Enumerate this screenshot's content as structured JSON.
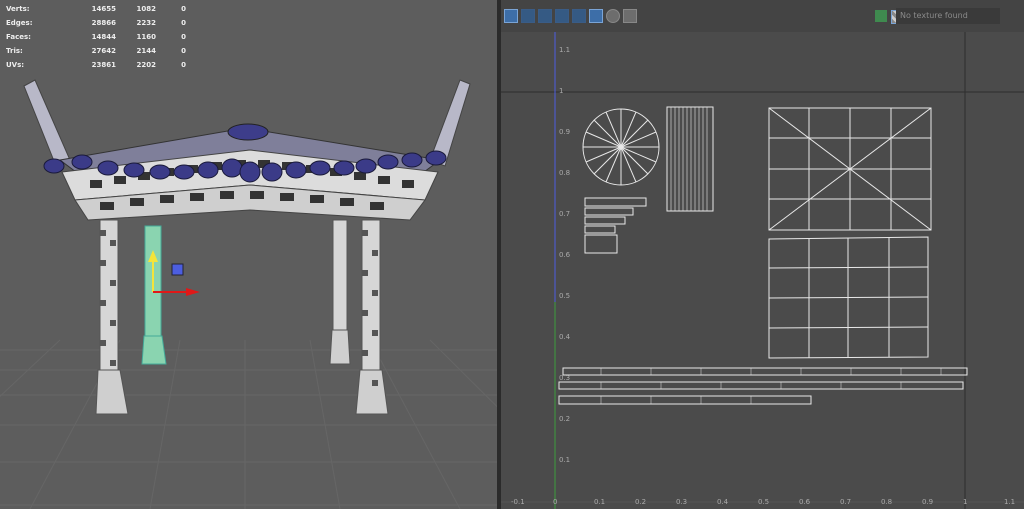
{
  "viewport": {
    "stats": [
      {
        "label": "Verts:",
        "v1": "14655",
        "v2": "1082",
        "v3": "0"
      },
      {
        "label": "Edges:",
        "v1": "28866",
        "v2": "2232",
        "v3": "0"
      },
      {
        "label": "Faces:",
        "v1": "14844",
        "v2": "1160",
        "v3": "0"
      },
      {
        "label": "Tris:",
        "v1": "27642",
        "v2": "2144",
        "v3": "0"
      },
      {
        "label": "UVs:",
        "v1": "23861",
        "v2": "2202",
        "v3": "0"
      }
    ]
  },
  "uv_editor": {
    "texture_placeholder": "No texture found",
    "x_ticks": [
      "-0.1",
      "0",
      "0.1",
      "0.2",
      "0.3",
      "0.4",
      "0.5",
      "0.6",
      "0.7",
      "0.8",
      "0.9",
      "1",
      "1.1"
    ],
    "y_ticks": [
      "1.1",
      "1",
      "0.9",
      "0.8",
      "0.7",
      "0.6",
      "0.5",
      "0.4",
      "0.3",
      "0.2",
      "0.1"
    ]
  },
  "colors": {
    "viewport_bg": "#5d5d5d",
    "uv_bg": "#4b4b4b",
    "grid_line": "#555555",
    "wire": "#e8e8e8",
    "axis_green": "#3e9e3e",
    "axis_blue": "#4c5ee0",
    "manipulator_red": "#e01818",
    "manipulator_yellow": "#f4e43a",
    "selected_highlight": "#66cc99"
  }
}
